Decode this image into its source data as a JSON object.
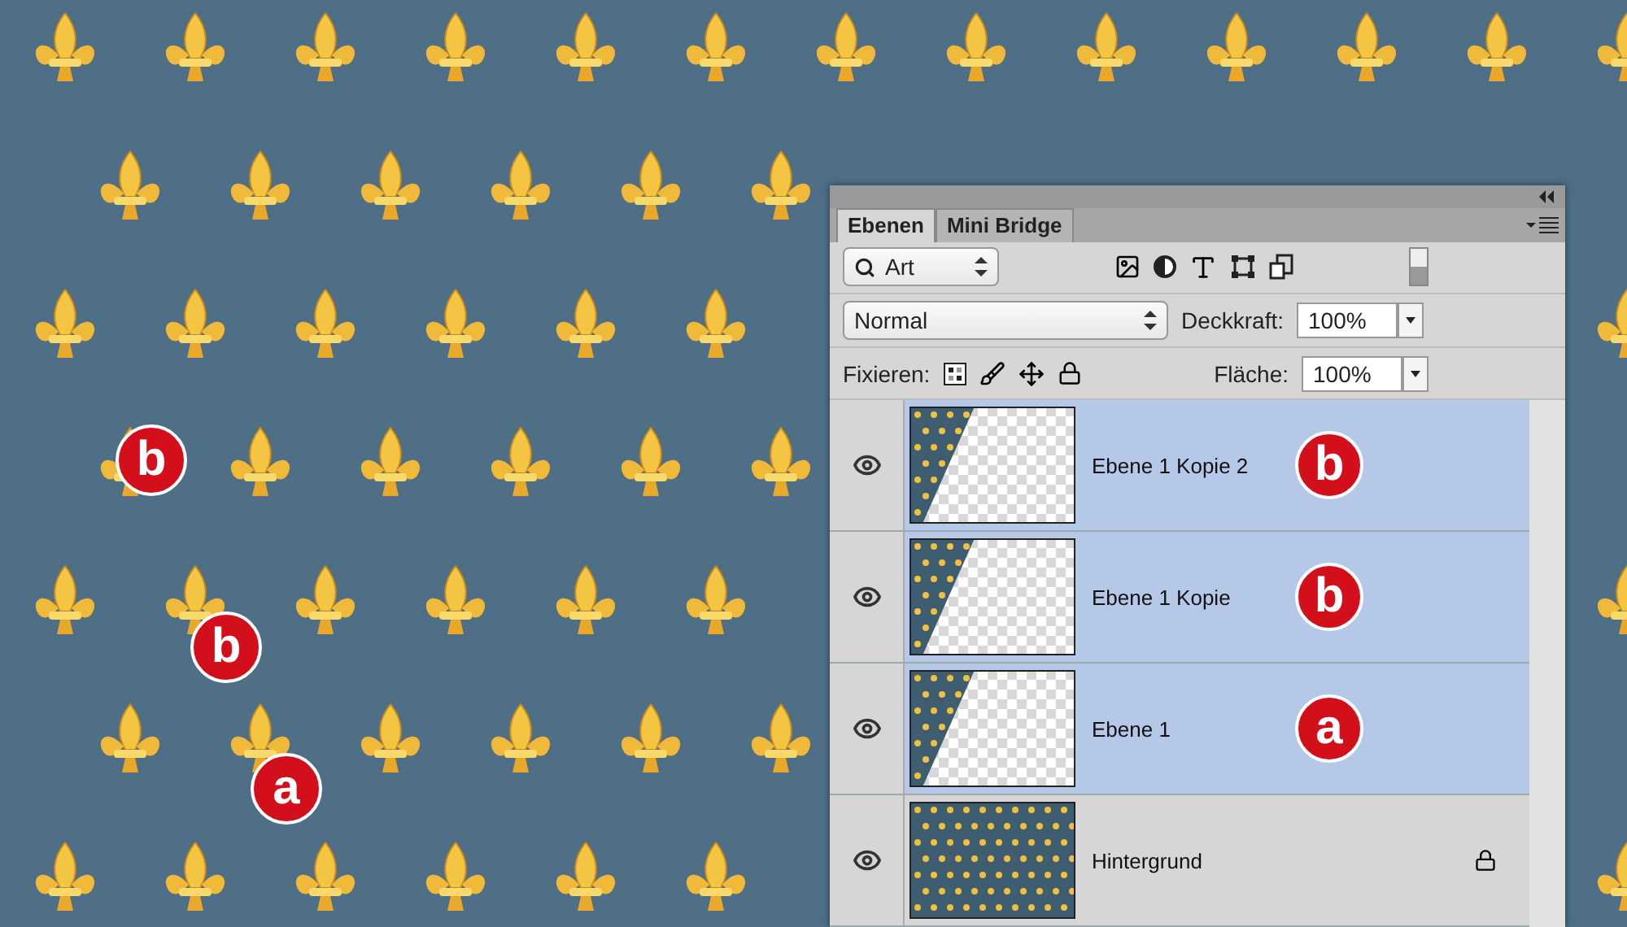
{
  "canvas": {
    "callouts": [
      {
        "label": "b"
      },
      {
        "label": "b"
      },
      {
        "label": "a"
      }
    ]
  },
  "panel": {
    "tabs": [
      {
        "label": "Ebenen",
        "selected": true
      },
      {
        "label": "Mini Bridge",
        "selected": false
      }
    ],
    "filter": {
      "value": "Art"
    },
    "blend_mode": {
      "value": "Normal"
    },
    "opacity": {
      "label": "Deckkraft:",
      "value": "100%"
    },
    "lock": {
      "label": "Fixieren:"
    },
    "fill": {
      "label": "Fläche:",
      "value": "100%"
    },
    "layers": [
      {
        "name": "Ebene 1 Kopie 2",
        "visible": true,
        "selected": true,
        "locked": false,
        "kind": "partial",
        "badge": "b"
      },
      {
        "name": "Ebene 1 Kopie",
        "visible": true,
        "selected": true,
        "locked": false,
        "kind": "partial",
        "badge": "b"
      },
      {
        "name": "Ebene 1",
        "visible": true,
        "selected": true,
        "locked": false,
        "kind": "partial",
        "badge": "a"
      },
      {
        "name": "Hintergrund",
        "visible": true,
        "selected": false,
        "locked": true,
        "kind": "full"
      }
    ]
  }
}
